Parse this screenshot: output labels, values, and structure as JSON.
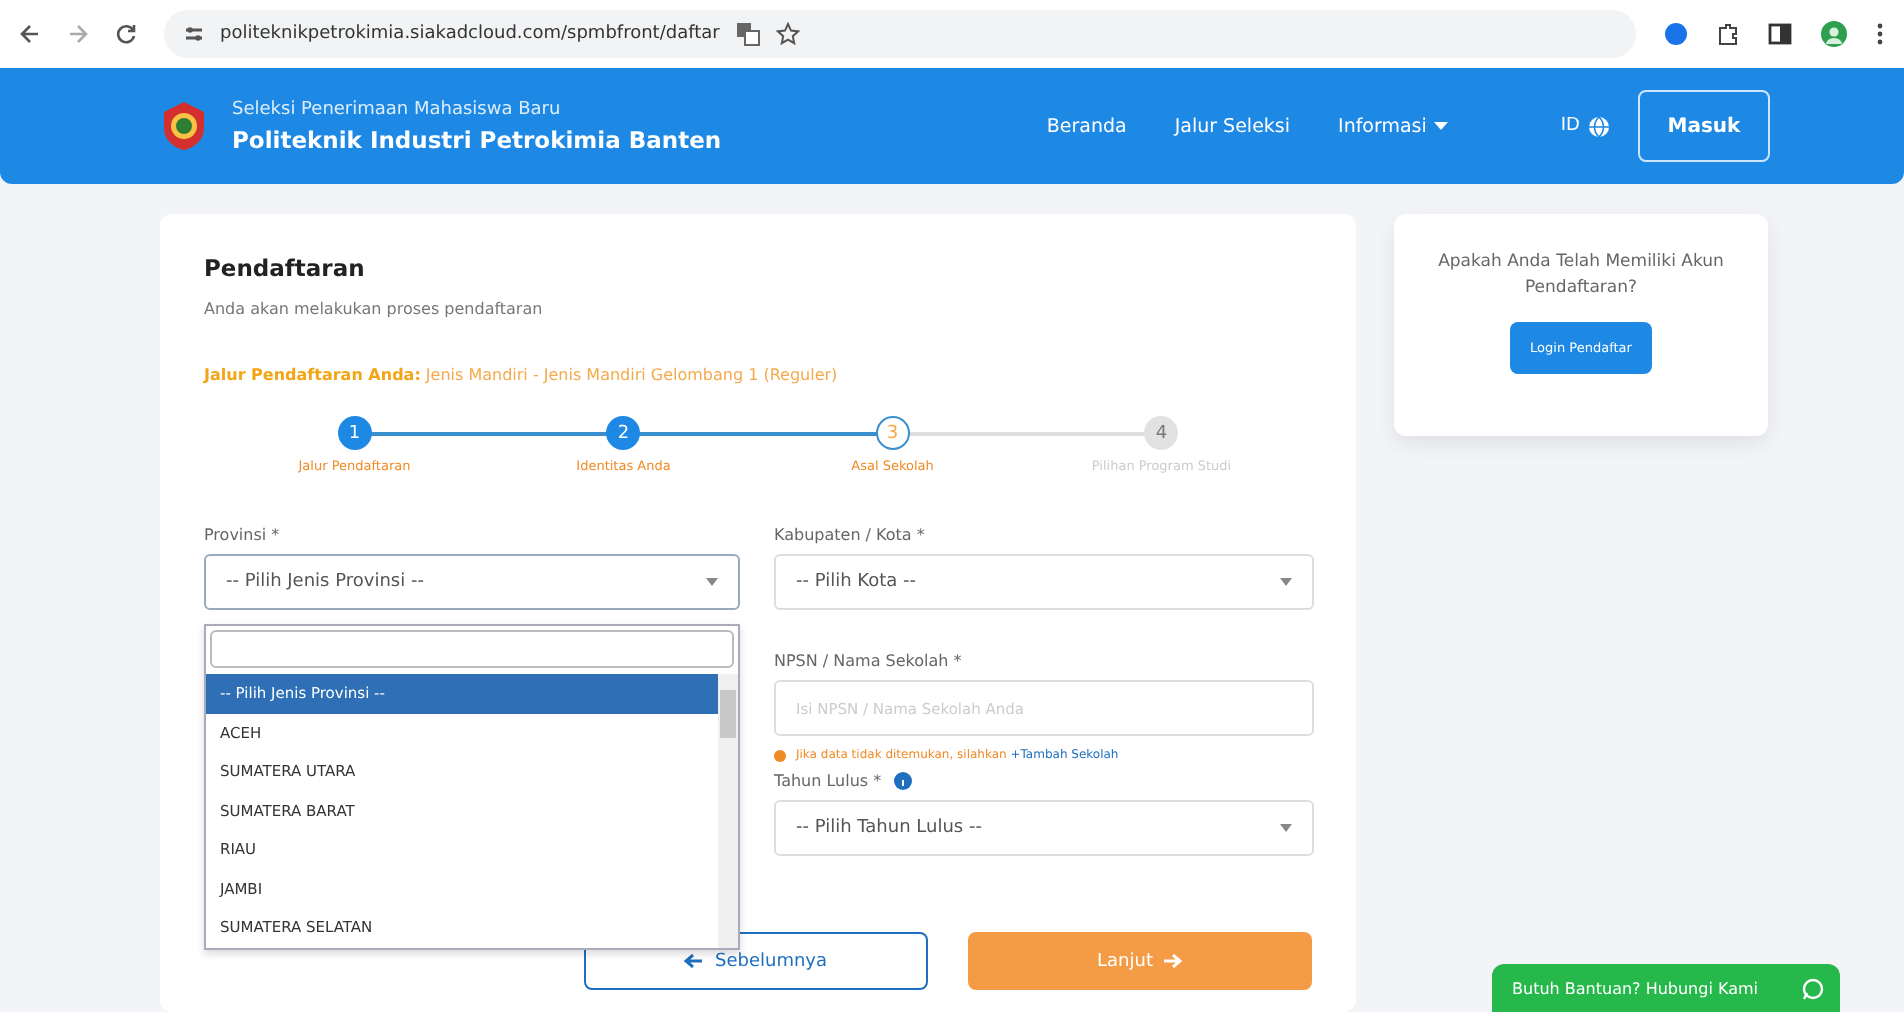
{
  "browser": {
    "url": "politeknikpetrokimia.siakadcloud.com/spmbfront/daftar"
  },
  "header": {
    "subtitle": "Seleksi Penerimaan Mahasiswa Baru",
    "title": "Politeknik Industri Petrokimia Banten",
    "nav": [
      {
        "label": "Beranda",
        "dropdown": false
      },
      {
        "label": "Jalur Seleksi",
        "dropdown": false
      },
      {
        "label": "Informasi",
        "dropdown": true
      }
    ],
    "language": "ID",
    "login": "Masuk"
  },
  "form": {
    "title": "Pendaftaran",
    "subtitle": "Anda akan melakukan proses pendaftaran",
    "route_label": "Jalur Pendaftaran Anda:",
    "route_value": "Jenis Mandiri - Jenis Mandiri Gelombang 1 (Reguler)",
    "steps": [
      {
        "number": "1",
        "label": "Jalur Pendaftaran",
        "done": true,
        "active": false
      },
      {
        "number": "2",
        "label": "Identitas Anda",
        "done": true,
        "active": false
      },
      {
        "number": "3",
        "label": "Asal Sekolah",
        "done": false,
        "active": true
      },
      {
        "number": "4",
        "label": "Pilihan Program Studi",
        "done": false,
        "active": false
      }
    ],
    "province": {
      "label": "Provinsi *",
      "value": "-- Pilih Jenis Provinsi --",
      "expanded": true,
      "options": [
        {
          "label": "-- Pilih Jenis Provinsi --",
          "selected": true
        },
        {
          "label": "ACEH",
          "selected": false
        },
        {
          "label": "SUMATERA UTARA",
          "selected": false
        },
        {
          "label": "SUMATERA BARAT",
          "selected": false
        },
        {
          "label": "RIAU",
          "selected": false
        },
        {
          "label": "JAMBI",
          "selected": false
        },
        {
          "label": "SUMATERA SELATAN",
          "selected": false
        }
      ]
    },
    "city": {
      "label": "Kabupaten / Kota *",
      "value": "-- Pilih Kota --"
    },
    "school": {
      "label": "NPSN / Nama Sekolah *",
      "placeholder": "Isi NPSN / Nama Sekolah Anda",
      "hint": "Jika data tidak ditemukan, silahkan",
      "hint_link": "+Tambah Sekolah"
    },
    "year": {
      "label": "Tahun Lulus *",
      "value": "-- Pilih Tahun Lulus --"
    },
    "back": "Sebelumnya",
    "next": "Lanjut"
  },
  "side": {
    "question": "Apakah Anda Telah Memiliki Akun Pendaftaran?",
    "button": "Login Pendaftar"
  },
  "help": {
    "label": "Butuh Bantuan? Hubungi Kami"
  }
}
